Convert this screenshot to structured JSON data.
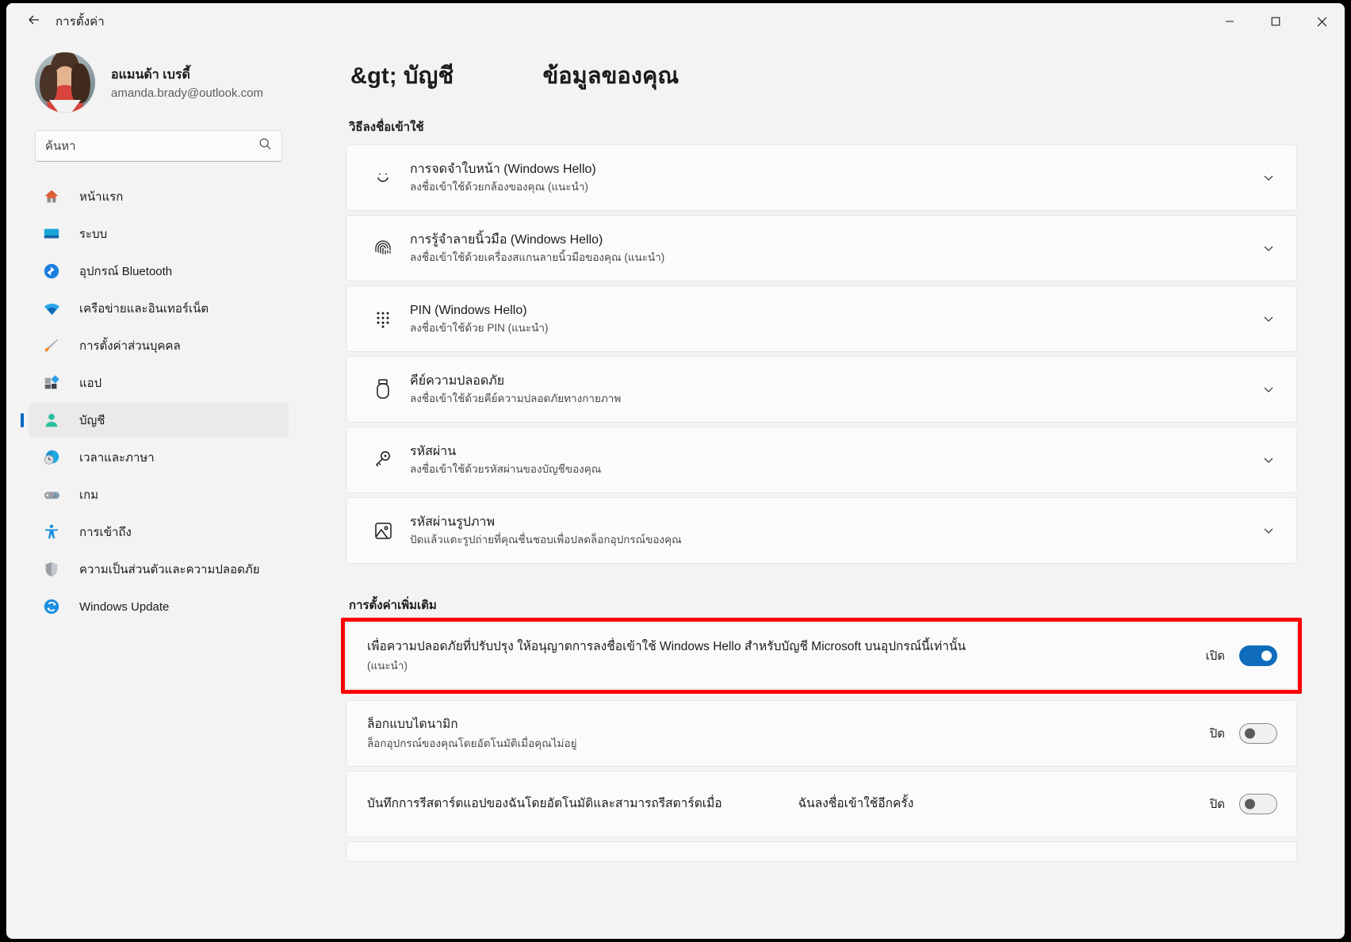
{
  "window": {
    "title": "การตั้งค่า",
    "back_icon": "back-arrow-icon",
    "minimize_label": "—",
    "maximize_label": "□",
    "close_label": "✕"
  },
  "sidebar": {
    "profile": {
      "name": "อแมนด้า เบรดี้",
      "email": "amanda.brady@outlook.com"
    },
    "search": {
      "placeholder": "ค้นหา",
      "value": "",
      "icon": "search-icon"
    },
    "items": [
      {
        "label": "หน้าแรก",
        "icon": "home-icon",
        "active": false
      },
      {
        "label": "ระบบ",
        "icon": "system-icon",
        "active": false
      },
      {
        "label": "อุปกรณ์ Bluetooth",
        "icon": "bluetooth-icon",
        "active": false
      },
      {
        "label": "เครือข่ายและอินเทอร์เน็ต",
        "icon": "wifi-icon",
        "active": false
      },
      {
        "label": "การตั้งค่าส่วนบุคคล",
        "icon": "paintbrush-icon",
        "active": false
      },
      {
        "label": "แอป",
        "icon": "apps-icon",
        "active": false
      },
      {
        "label": "บัญชี",
        "icon": "accounts-person-icon",
        "active": true
      },
      {
        "label": "เวลาและภาษา",
        "icon": "time-language-icon",
        "active": false
      },
      {
        "label": "เกม",
        "icon": "gaming-controller-icon",
        "active": false
      },
      {
        "label": "การเข้าถึง",
        "icon": "accessibility-icon",
        "active": false
      },
      {
        "label": "ความเป็นส่วนตัวและความปลอดภัย",
        "icon": "shield-icon",
        "active": false
      },
      {
        "label": "Windows Update",
        "icon": "update-refresh-icon",
        "active": false
      }
    ]
  },
  "main": {
    "breadcrumb": "&gt; บัญชี",
    "page_title": "ข้อมูลของคุณ",
    "signin_section_label": "วิธีลงชื่อเข้าใช้",
    "signin_options": [
      {
        "icon": "face-smile-icon",
        "title": "การจดจำใบหน้า (Windows Hello)",
        "subtitle": "ลงชื่อเข้าใช้ด้วยกล้องของคุณ (แนะนำ)",
        "chevron": "chevron-down-icon"
      },
      {
        "icon": "fingerprint-icon",
        "title": "การรู้จำลายนิ้วมือ (Windows Hello)",
        "subtitle": "ลงชื่อเข้าใช้ด้วยเครื่องสแกนลายนิ้วมือของคุณ (แนะนำ)",
        "chevron": "chevron-down-icon"
      },
      {
        "icon": "pin-keypad-icon",
        "title": "PIN (Windows Hello)",
        "subtitle": "ลงชื่อเข้าใช้ด้วย    PIN (แนะนำ)",
        "chevron": "chevron-down-icon"
      },
      {
        "icon": "security-key-icon",
        "title": "คีย์ความปลอดภัย",
        "subtitle": "ลงชื่อเข้าใช้ด้วยคีย์ความปลอดภัยทางกายภาพ",
        "chevron": "chevron-down-icon"
      },
      {
        "icon": "key-icon",
        "title": "รหัสผ่าน",
        "subtitle": "ลงชื่อเข้าใช้ด้วยรหัสผ่านของบัญชีของคุณ",
        "chevron": "chevron-down-icon"
      },
      {
        "icon": "picture-password-icon",
        "title": "รหัสผ่านรูปภาพ",
        "subtitle": "ปัดแล้วแตะรูปถ่ายที่คุณชื่นชอบเพื่อปลดล็อกอุปกรณ์ของคุณ",
        "chevron": "chevron-down-icon"
      }
    ],
    "additional_section_label": "การตั้งค่าเพิ่มเติม",
    "additional_settings": [
      {
        "title": "เพื่อความปลอดภัยที่ปรับปรุง ให้อนุญาตการลงชื่อเข้าใช้ Windows Hello สำหรับบัญชี Microsoft บนอุปกรณ์นี้เท่านั้น",
        "subtitle": "(แนะนำ)",
        "state_label": "เปิด",
        "state": "on",
        "highlighted": true
      },
      {
        "title": "ล็อกแบบไดนามิก",
        "subtitle": "ล็อกอุปกรณ์ของคุณโดยอัตโนมัติเมื่อคุณไม่อยู่",
        "state_label": "ปิด",
        "state": "off",
        "highlighted": false
      },
      {
        "title": "บันทึกการรีสตาร์ตแอปของฉันโดยอัตโนมัติและสามารถรีสตาร์ตเมื่อ",
        "title_extra": "ฉันลงชื่อเข้าใช้อีกครั้ง",
        "subtitle": "",
        "state_label": "ปิด",
        "state": "off",
        "highlighted": false
      }
    ]
  },
  "colors": {
    "accent": "#0067c0",
    "toggle_on": "#0f6cbd",
    "annotation": "#fd0000",
    "page_bg": "#f3f3f3",
    "card_bg": "#fbfbfb"
  }
}
